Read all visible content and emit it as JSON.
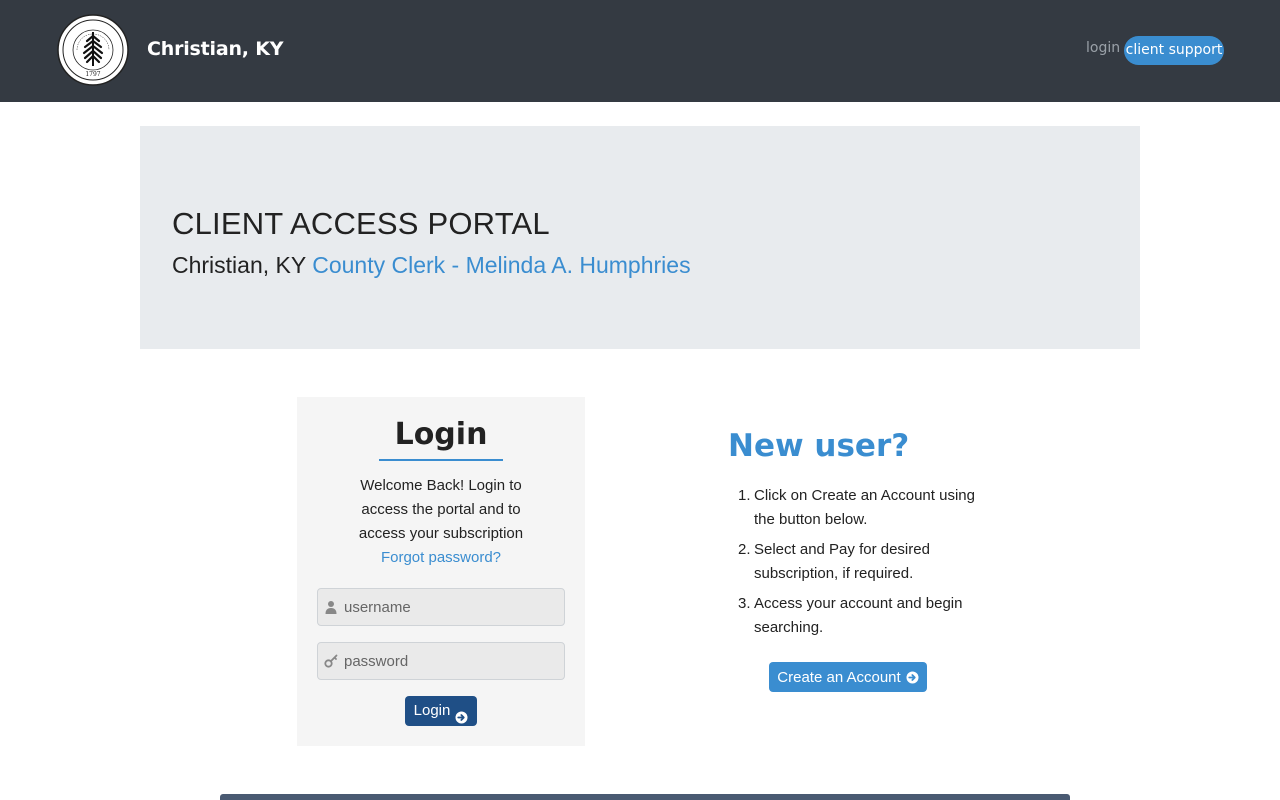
{
  "header": {
    "seal_icon": "county-seal-logo",
    "seal_text": "CHRISTIAN COUNTY, KENTUCKY 1797",
    "site_title": "Christian, KY",
    "nav_login": "login",
    "nav_support": "client support"
  },
  "hero": {
    "title": "CLIENT ACCESS PORTAL",
    "location": "Christian, KY",
    "office": "County Clerk - Melinda A. Humphries"
  },
  "login": {
    "heading": "Login",
    "welcome": "Welcome Back! Login to access the portal and to access your subscription",
    "forgot": "Forgot password?",
    "username_placeholder": "username",
    "password_placeholder": "password",
    "button": "Login"
  },
  "new_user": {
    "title": "New user?",
    "steps": [
      "Click on Create an Account using the button below.",
      "Select and Pay for desired subscription, if required.",
      "Access your account and begin searching."
    ],
    "step_numbers": [
      "1.",
      "2.",
      "3."
    ],
    "button": "Create an Account"
  },
  "colors": {
    "header_bg": "#343a42",
    "accent": "#3a8dd0",
    "login_button": "#1f4f86",
    "hero_bg": "#e8ebee"
  }
}
